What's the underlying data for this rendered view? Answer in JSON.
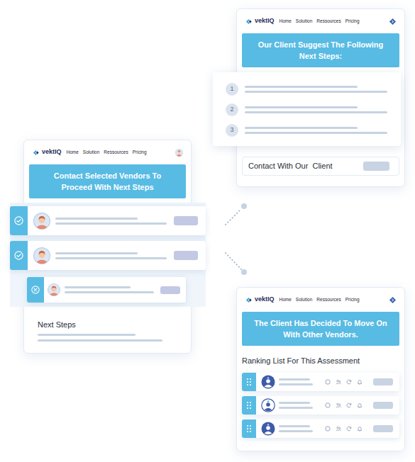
{
  "suggest_window": {
    "logo": "vektIQ",
    "nav": [
      "Home",
      "Solution",
      "Ressources",
      "Pricing"
    ],
    "banner": "Our Client Suggest The Following Next Steps:",
    "steps": [
      "1",
      "2",
      "3"
    ],
    "contact_label": "Contact With Our  Client"
  },
  "vendor_window": {
    "logo": "vektIQ",
    "nav": [
      "Home",
      "Solution",
      "Ressources",
      "Pricing"
    ],
    "banner": "Contact Selected Vendors To Proceed With Next Steps",
    "vendors": [
      {
        "selected": true
      },
      {
        "selected": true
      },
      {
        "selected": false
      }
    ],
    "next_steps": "Next Steps"
  },
  "declined_window": {
    "logo": "vektIQ",
    "nav": [
      "Home",
      "Solution",
      "Ressources",
      "Pricing"
    ],
    "banner": "The Client Has Decided To Move On With Other Vendors.",
    "ranking_title": "Ranking List For This Assessment",
    "rankings": [
      {
        "kind": "filled"
      },
      {
        "kind": "outline"
      },
      {
        "kind": "filled"
      }
    ]
  }
}
